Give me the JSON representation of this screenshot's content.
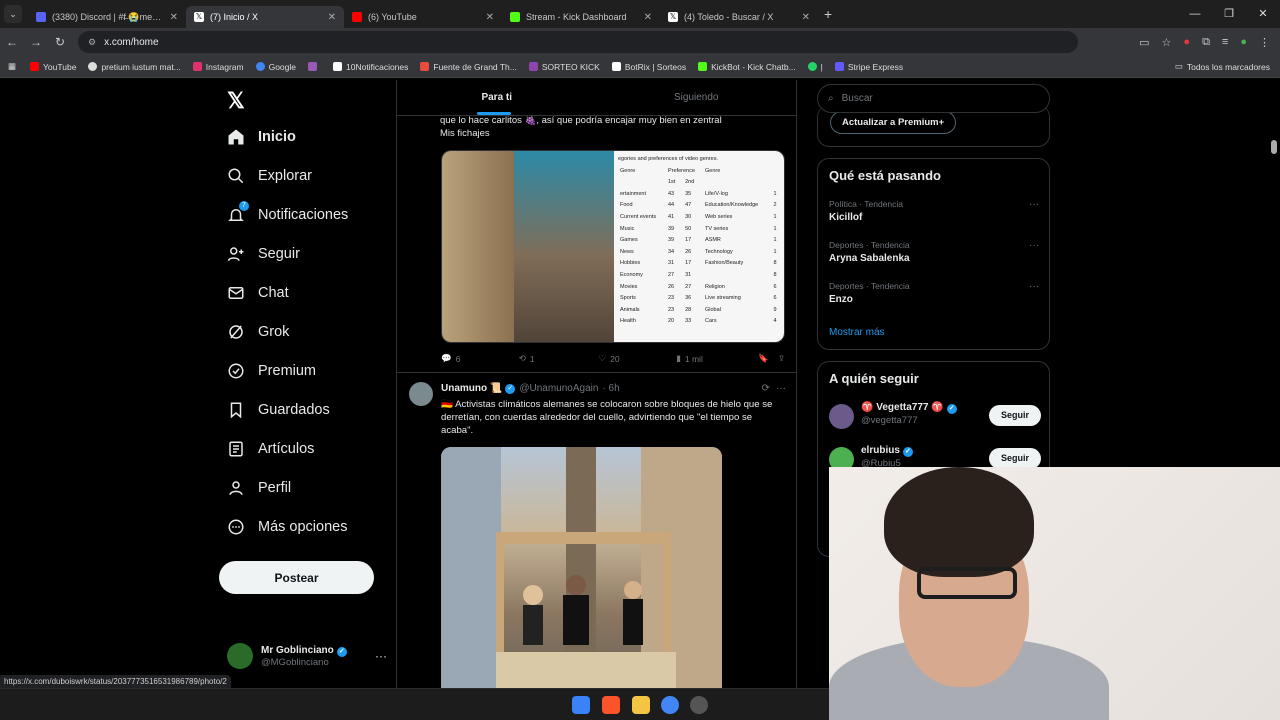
{
  "browser": {
    "tabs": [
      {
        "title": "(3380) Discord | #f̶ 😭memes",
        "color": "#5865f2"
      },
      {
        "title": "(7) Inicio / X",
        "color": "#ffffff"
      },
      {
        "title": "(6) YouTube",
        "color": "#ff0000"
      },
      {
        "title": "Stream - Kick Dashboard",
        "color": "#53fc18"
      },
      {
        "title": "(4) Toledo - Buscar / X",
        "color": "#ffffff"
      }
    ],
    "url": "x.com/home",
    "bookmarks": [
      {
        "label": "YouTube",
        "color": "#ff0000"
      },
      {
        "label": "pretium iustum mat...",
        "color": "#dddddd"
      },
      {
        "label": "Instagram",
        "color": "#e1306c"
      },
      {
        "label": "Google",
        "color": "#4285f4"
      },
      {
        "label": "",
        "color": "#9b59b6"
      },
      {
        "label": "10Notificaciones",
        "color": "#ffffff"
      },
      {
        "label": "Fuente de Grand Th...",
        "color": "#e74c3c"
      },
      {
        "label": "SORTEO KICK",
        "color": "#8e44ad"
      },
      {
        "label": "BotRix | Sorteos",
        "color": "#ffffff"
      },
      {
        "label": "KickBot - Kick Chatb...",
        "color": "#53fc18"
      },
      {
        "label": "|",
        "color": "#25d366"
      },
      {
        "label": "Stripe Express",
        "color": "#635bff"
      }
    ],
    "all_bookmarks": "Todos los marcadores",
    "status_url": "https://x.com/duboiswrk/status/2037773516531986789/photo/2"
  },
  "sidebar": {
    "items": [
      {
        "label": "Inicio",
        "icon": "home-icon"
      },
      {
        "label": "Explorar",
        "icon": "search-icon"
      },
      {
        "label": "Notificaciones",
        "icon": "bell-icon"
      },
      {
        "label": "Seguir",
        "icon": "person-plus-icon"
      },
      {
        "label": "Chat",
        "icon": "mail-icon"
      },
      {
        "label": "Grok",
        "icon": "grok-icon"
      },
      {
        "label": "Premium",
        "icon": "premium-icon"
      },
      {
        "label": "Guardados",
        "icon": "bookmark-icon"
      },
      {
        "label": "Artículos",
        "icon": "articles-icon"
      },
      {
        "label": "Perfil",
        "icon": "person-icon"
      },
      {
        "label": "Más opciones",
        "icon": "more-icon"
      }
    ],
    "notif_count": "7",
    "post_label": "Postear",
    "user": {
      "name": "Mr Goblinciano",
      "handle": "@MGoblinciano"
    }
  },
  "feed": {
    "tabs": [
      "Para ti",
      "Siguiendo"
    ],
    "tweet1": {
      "text_line1": "que lo hace carlitos 🍇, así que podría encajar muy bien en zentral",
      "text_line2": "Mis fichajes",
      "table_header": "egories and preferences of video genres.",
      "table_cols": [
        "Genre",
        "Preference",
        "Genre",
        "1st",
        "2nd"
      ],
      "table_rows": [
        [
          "ertainment",
          "43",
          "35",
          "Life/V-log",
          "1"
        ],
        [
          "Food",
          "44",
          "47",
          "Education/Knowledge",
          "2"
        ],
        [
          "Current events",
          "41",
          "30",
          "Web series",
          "1"
        ],
        [
          "Music",
          "39",
          "50",
          "TV series",
          "1"
        ],
        [
          "Games",
          "39",
          "17",
          "ASMR",
          "1"
        ],
        [
          "News",
          "34",
          "26",
          "Technology",
          "1"
        ],
        [
          "Hobbies",
          "31",
          "17",
          "Fashion/Beauty",
          "8"
        ],
        [
          "Economy",
          "27",
          "31",
          "",
          "8"
        ],
        [
          "Movies",
          "26",
          "27",
          "Religion",
          "6"
        ],
        [
          "Sports",
          "23",
          "36",
          "Live streaming",
          "6"
        ],
        [
          "Animals",
          "23",
          "28",
          "Global",
          "9"
        ],
        [
          "Health",
          "20",
          "33",
          "Cars",
          "4"
        ]
      ],
      "replies": "6",
      "reposts": "1",
      "likes": "20",
      "views": "1 mil"
    },
    "tweet2": {
      "name": "Unamuno 📜",
      "handle": "@UnamunoAgain",
      "time": "· 6h",
      "text": "🇩🇪 Activistas climáticos alemanes se colocaron sobre bloques de hielo que se derretían, con cuerdas alrededor del cuello, advirtiendo que \"el tiempo se acaba\"."
    }
  },
  "right": {
    "search_placeholder": "Buscar",
    "premium_button": "Actualizar a Premium+",
    "trends_title": "Qué está pasando",
    "trends": [
      {
        "category": "Política · Tendencia",
        "name": "Kicillof"
      },
      {
        "category": "Deportes · Tendencia",
        "name": "Aryna Sabalenka"
      },
      {
        "category": "Deportes · Tendencia",
        "name": "Enzo"
      }
    ],
    "show_more": "Mostrar más",
    "follow_title": "A quién seguir",
    "follow": [
      {
        "name": "♈ Vegetta777 ♈",
        "handle": "@vegetta777",
        "button": "Seguir",
        "color": "#6b5b8a"
      },
      {
        "name": "elrubius",
        "handle": "@Rubiu5",
        "button": "Seguir",
        "color": "#4caf50"
      }
    ]
  }
}
